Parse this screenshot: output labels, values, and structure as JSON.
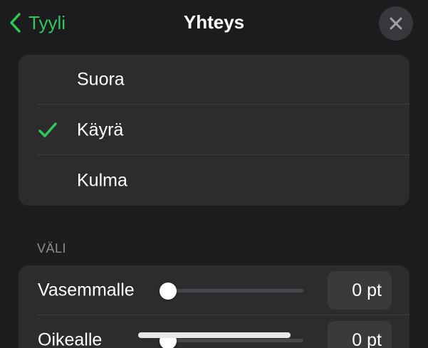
{
  "header": {
    "back_label": "Tyyli",
    "title": "Yhteys"
  },
  "connection": {
    "options": [
      {
        "label": "Suora",
        "selected": false
      },
      {
        "label": "Käyrä",
        "selected": true
      },
      {
        "label": "Kulma",
        "selected": false
      }
    ]
  },
  "spacing": {
    "section_title": "VÄLI",
    "rows": [
      {
        "label": "Vasemmalle",
        "value": "0 pt",
        "slider_fraction": 0
      },
      {
        "label": "Oikealle",
        "value": "0 pt",
        "slider_fraction": 0
      }
    ]
  },
  "colors": {
    "accent": "#32c759",
    "background": "#1c1c1e",
    "group_background": "#2c2c2e"
  },
  "icons": {
    "back": "chevron-left-icon",
    "close": "close-icon",
    "selected": "checkmark-icon"
  }
}
